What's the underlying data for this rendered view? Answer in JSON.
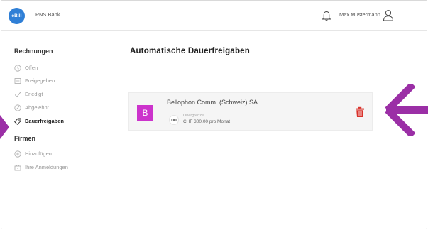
{
  "header": {
    "logo_text": "eBill",
    "bank_name": "PNS Bank",
    "user_name": "Max Mustermann",
    "icons": {
      "notifications": "bell-icon",
      "user": "user-icon"
    }
  },
  "sidebar": {
    "sections": [
      {
        "title": "Rechnungen",
        "items": [
          {
            "label": "Offen",
            "icon": "clock-icon",
            "active": false
          },
          {
            "label": "Freigegeben",
            "icon": "approved-icon",
            "active": false
          },
          {
            "label": "Erledigt",
            "icon": "checkmark-icon",
            "active": false
          },
          {
            "label": "Abgelehnt",
            "icon": "rejected-icon",
            "active": false
          },
          {
            "label": "Dauerfreigaben",
            "icon": "tag-icon",
            "active": true
          }
        ]
      },
      {
        "title": "Firmen",
        "items": [
          {
            "label": "Hinzufügen",
            "icon": "plus-circle-icon",
            "active": false
          },
          {
            "label": "Ihre Anmeldungen",
            "icon": "registrations-icon",
            "active": false
          }
        ]
      }
    ]
  },
  "main": {
    "title": "Automatische Dauerfreigaben",
    "approvals": [
      {
        "logo_letter": "B",
        "merchant": "Bellophon Comm. (Schweiz) SA",
        "limit_label": "Obergrenze",
        "limit_value": "CHF 300.00 pro Monat"
      }
    ]
  },
  "colors": {
    "accent_logo": "#2f7fd6",
    "merchant_logo": "#cc33cc",
    "delete": "#d9322b",
    "annotation_arrow": "#9b2fa6"
  }
}
